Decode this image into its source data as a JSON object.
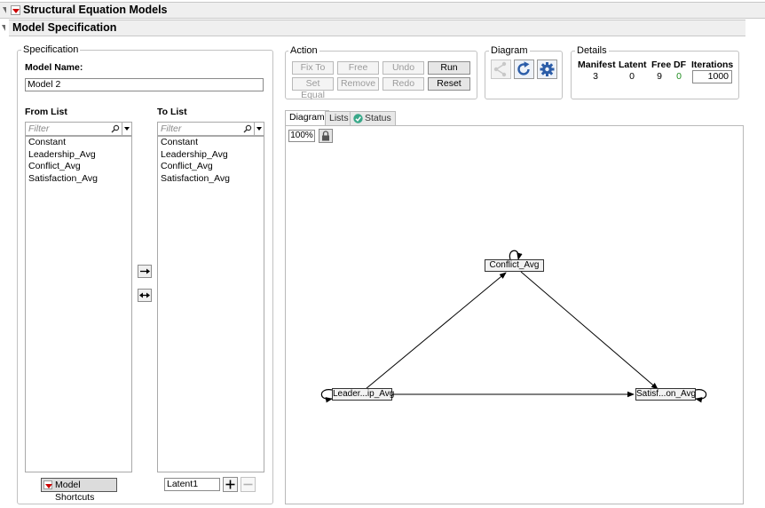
{
  "window": {
    "title": "Structural Equation Models",
    "subtitle": "Model Specification"
  },
  "specification": {
    "group_label": "Specification",
    "model_name_label": "Model Name:",
    "model_name_value": "Model 2",
    "from_list": {
      "label": "From List",
      "filter_placeholder": "Filter",
      "items": [
        "Constant",
        "Leadership_Avg",
        "Conflict_Avg",
        "Satisfaction_Avg"
      ]
    },
    "to_list": {
      "label": "To List",
      "filter_placeholder": "Filter",
      "items": [
        "Constant",
        "Leadership_Avg",
        "Conflict_Avg",
        "Satisfaction_Avg"
      ]
    },
    "model_shortcuts_label": "Model Shortcuts",
    "latent_name_value": "Latent1"
  },
  "action": {
    "group_label": "Action",
    "buttons": {
      "fix_to": "Fix To",
      "free": "Free",
      "undo": "Undo",
      "run": "Run",
      "set_equal": "Set Equal",
      "remove": "Remove",
      "redo": "Redo",
      "reset": "Reset"
    }
  },
  "diagram_group": {
    "group_label": "Diagram"
  },
  "details": {
    "group_label": "Details",
    "headers": {
      "manifest": "Manifest",
      "latent": "Latent",
      "free": "Free",
      "df": "DF",
      "iterations": "Iterations"
    },
    "values": {
      "manifest": "3",
      "latent": "0",
      "free": "9",
      "df": "0",
      "iterations": "1000"
    },
    "df_color": "#1e8c1e"
  },
  "tabs": {
    "diagram": "Diagram",
    "lists": "Lists",
    "status": "Status"
  },
  "canvas": {
    "zoom": "100%",
    "nodes": {
      "conflict": "Conflict_Avg",
      "leadership": "Leader...ip_Avg",
      "satisfaction": "Satisf...on_Avg"
    }
  },
  "icons": [
    "disclosure-triangle-icon",
    "red-menu-triangle-icon",
    "search-icon",
    "arrow-right-icon",
    "arrow-bidirectional-icon",
    "refresh-icon",
    "gear-icon",
    "lock-icon",
    "plus-icon",
    "minus-icon",
    "check-circle-icon"
  ]
}
